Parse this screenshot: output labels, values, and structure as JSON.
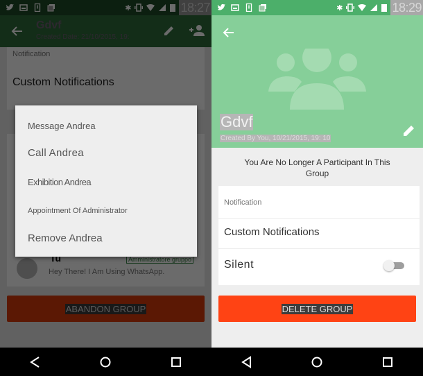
{
  "left_screen": {
    "status_bar": {
      "icons_left": [
        "twitter-icon",
        "image-icon",
        "download-icon",
        "photos-icon"
      ],
      "icons_right": [
        "bluetooth-icon",
        "vibrate-icon",
        "wifi-icon",
        "signal-icon",
        "battery-icon"
      ],
      "time": "18:27"
    },
    "toolbar": {
      "title": "Gdvf",
      "subtitle": "Created Date: 21/10/2015, 19:"
    },
    "notification_card": {
      "label": "Notification",
      "custom_notifications": "Custom Notifications"
    },
    "participant": {
      "name": "Tu",
      "badge": "Amministratore gruppo",
      "status": "Hey There! I Am Using WhatsApp."
    },
    "abandon_button": "ABANDON GROUP",
    "dialog": {
      "items": [
        {
          "label": "Message Andrea"
        },
        {
          "label": "Call Andrea"
        },
        {
          "label": "Exhibition Andrea"
        },
        {
          "label": "Appointment Of Administrator"
        },
        {
          "label": "Remove Andrea"
        }
      ]
    },
    "nav_bar": {
      "back": "back-icon",
      "home": "home-icon",
      "recents": "recents-icon"
    }
  },
  "right_screen": {
    "status_bar": {
      "icons_left": [
        "twitter-icon",
        "image-icon",
        "download-icon",
        "photos-icon"
      ],
      "icons_right": [
        "bluetooth-icon",
        "vibrate-icon",
        "wifi-icon",
        "signal-icon",
        "battery-icon"
      ],
      "time": "18:29"
    },
    "header": {
      "title": "Gdvf",
      "subtitle": "Created By You, 10/21/2015, 19: 10"
    },
    "info_text": "You Are No Longer A Participant In This Group",
    "notification_card": {
      "label": "Notification",
      "custom_notifications": "Custom Notifications",
      "silent_label": "Silent",
      "silent_on": false
    },
    "delete_button": "DELETE GROUP",
    "nav_bar": {
      "back": "back-icon",
      "home": "home-icon",
      "recents": "recents-icon"
    }
  }
}
